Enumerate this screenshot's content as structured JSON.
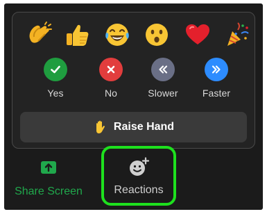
{
  "popup": {
    "emoji_reactions": [
      {
        "name": "clapping-hands"
      },
      {
        "name": "thumbs-up"
      },
      {
        "name": "tears-of-joy"
      },
      {
        "name": "open-mouth"
      },
      {
        "name": "red-heart"
      },
      {
        "name": "party-popper"
      }
    ],
    "feedback": [
      {
        "label": "Yes",
        "icon": "checkmark-icon",
        "color": "#1f9d3f"
      },
      {
        "label": "No",
        "icon": "x-icon",
        "color": "#e23d3d"
      },
      {
        "label": "Slower",
        "icon": "rewind-icon",
        "color": "#6a6f86"
      },
      {
        "label": "Faster",
        "icon": "fast-forward-icon",
        "color": "#2d8cff"
      }
    ],
    "raise_hand_label": "Raise Hand"
  },
  "toolbar": {
    "share_screen_label": "Share Screen",
    "reactions_label": "Reactions"
  },
  "colors": {
    "share_green": "#20a84c",
    "highlight_green": "#1ee01e",
    "popup_bg": "#232323"
  }
}
